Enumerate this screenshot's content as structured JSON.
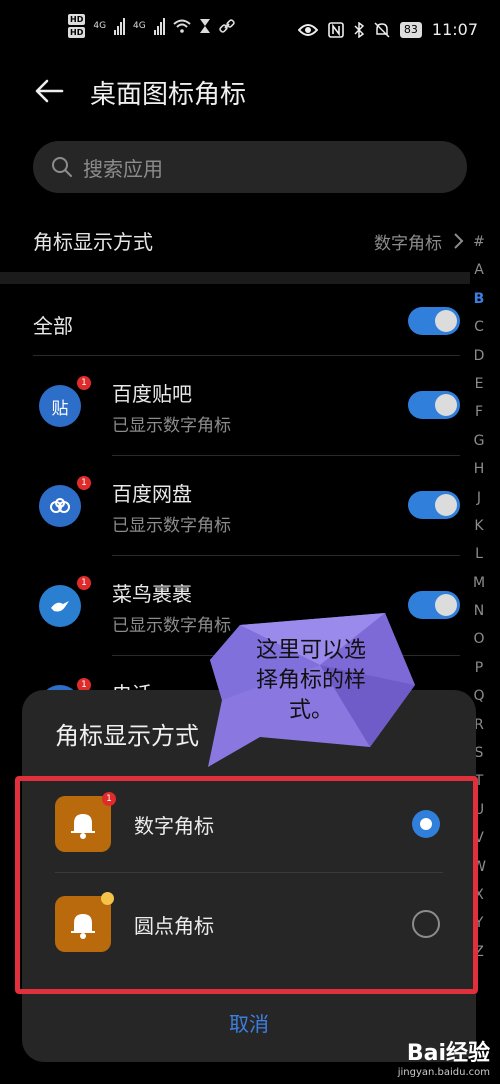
{
  "status_bar": {
    "network_1": "4G",
    "network_2": "4G",
    "battery": "83",
    "time": "11:07"
  },
  "header": {
    "title": "桌面图标角标"
  },
  "search": {
    "placeholder": "搜索应用"
  },
  "badge_mode": {
    "label": "角标显示方式",
    "value": "数字角标"
  },
  "all_row": {
    "label": "全部",
    "enabled": true
  },
  "apps": [
    {
      "name": "百度贴吧",
      "status": "已显示数字角标",
      "icon_text": "贴",
      "badge": "1",
      "enabled": true
    },
    {
      "name": "百度网盘",
      "status": "已显示数字角标",
      "icon_text": "",
      "badge": "1",
      "enabled": true
    },
    {
      "name": "菜鸟裹裹",
      "status": "已显示数字角标",
      "icon_text": "",
      "badge": "1",
      "enabled": true
    },
    {
      "name": "电话",
      "status": "",
      "icon_text": "",
      "badge": "1",
      "enabled": true
    }
  ],
  "index_letters": [
    "#",
    "A",
    "B",
    "C",
    "D",
    "E",
    "F",
    "G",
    "H",
    "J",
    "K",
    "L",
    "M",
    "N",
    "O",
    "P",
    "Q",
    "R",
    "S",
    "T",
    "U",
    "V",
    "W",
    "X",
    "Y",
    "Z"
  ],
  "index_active": "B",
  "sheet": {
    "title": "角标显示方式",
    "options": [
      {
        "label": "数字角标",
        "selected": true,
        "badge": "1"
      },
      {
        "label": "圆点角标",
        "selected": false
      }
    ],
    "cancel_label": "取消"
  },
  "annotation": {
    "text": "这里可以选择角标的样式。"
  },
  "watermark": {
    "brand": "Bai经验",
    "url": "jingyan.baidu.com"
  },
  "colors": {
    "accent": "#2f7fdb",
    "highlight_border": "#e0303b",
    "bell_bg": "#b86a0c",
    "bubble": "#8a78e0"
  }
}
